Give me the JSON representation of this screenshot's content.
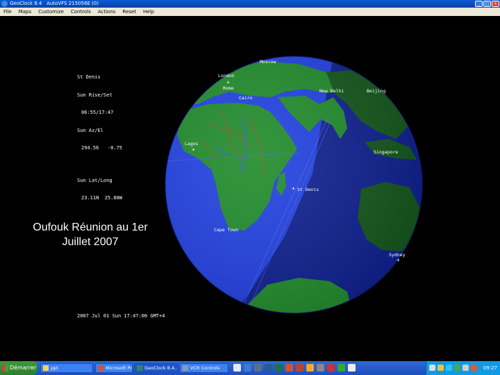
{
  "window": {
    "title": "GeoClock 8.4   AutoVFS 215056E (0)",
    "menu": [
      "File",
      "Maps",
      "Customize",
      "Controls",
      "Actions",
      "Reset",
      "Help"
    ]
  },
  "info_panel": {
    "location": "St Denis",
    "rise_set_label": "Sun Rise/Set",
    "rise_set_value": "06:55/17:47",
    "az_el_label": "Sun Az/El",
    "az_el_value": "294.56   -0.75",
    "lat_long_label": "Sun Lat/Long",
    "lat_long_value": "23.11N  25.88W"
  },
  "cities": [
    "Moscow",
    "London",
    "Rome",
    "Cairo",
    "New Delhi",
    "Beijing",
    "Lagos",
    "Singapore",
    "St Denis",
    "Cape Town",
    "Sydney"
  ],
  "status_line": "2007 Jul 01 Sun 17:47:00 GMT+4",
  "caption": {
    "line1": "Oufouk Réunion au 1er",
    "line2": "Juillet 2007"
  },
  "colors": {
    "ocean_day": "#1f3fe0",
    "ocean_night": "#0c1e8e",
    "land_day": "#1f8a2a",
    "land_night": "#12551a",
    "borders": "#c0392b",
    "rivers": "#3650ff"
  },
  "taskbar": {
    "start_label": "Démarrer",
    "tasks": [
      "ppt",
      "Microsoft Po...",
      "GeoClock 8.4...",
      "VCR Controls"
    ],
    "clock": "09:27"
  }
}
